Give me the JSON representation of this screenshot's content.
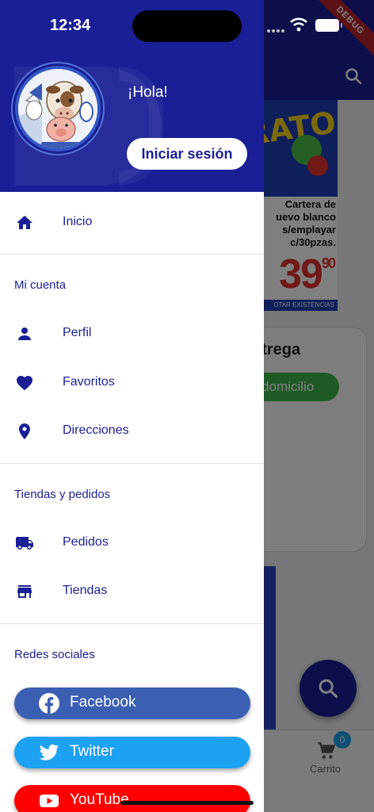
{
  "status_bar": {
    "time": "12:34"
  },
  "debug_banner": "DEBUG",
  "drawer": {
    "greeting": "¡Hola!",
    "login_button": "Iniciar sesión",
    "items": {
      "home": "Inicio",
      "account_section": "Mi cuenta",
      "profile": "Perfil",
      "favorites": "Favoritos",
      "addresses": "Direcciones",
      "stores_section": "Tiendas y pedidos",
      "orders": "Pedidos",
      "stores": "Tiendas",
      "social_section": "Redes sociales"
    },
    "social": {
      "facebook": "Facebook",
      "twitter": "Twitter",
      "youtube": "YouTube"
    }
  },
  "background": {
    "promo_burst": "RATO",
    "promo_text": [
      "Cartera de",
      "uevo blanco",
      "s/emplayar",
      "c/30pzas."
    ],
    "promo_price": "39",
    "promo_cents": "90",
    "promo_footer": "OTAR EXISTENCIAS",
    "card_title": "ntrega",
    "card_chip": "a domicilio",
    "cart_count": "0",
    "cart_label": "Carrito"
  },
  "colors": {
    "primary": "#1a1f96",
    "facebook": "#3b5fb3",
    "twitter": "#1da1f2",
    "youtube": "#ff0000",
    "delivery_chip": "#3fb54a"
  }
}
